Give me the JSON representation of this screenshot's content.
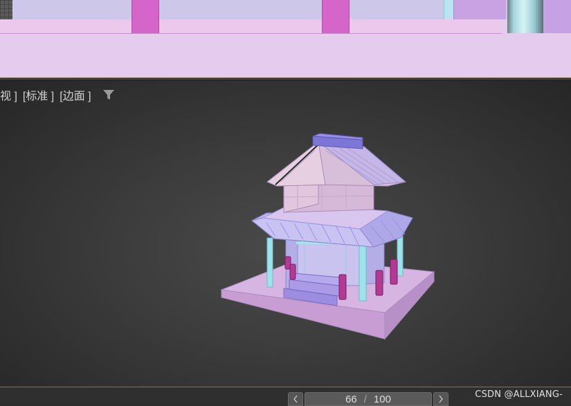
{
  "viewport_label": {
    "view_mode": "视 ]",
    "shading_mode": "[标准 ]",
    "display_mode": "[边面 ]",
    "filter_icon": "filter-icon"
  },
  "time_slider": {
    "current_frame": "66",
    "separator": "/",
    "total_frames": "100",
    "prev_icon": "chevron-left-icon",
    "next_icon": "chevron-right-icon"
  },
  "watermark": "CSDN @ALLXIANG-",
  "colors": {
    "model_pink": "#e2b9e8",
    "model_lavender": "#a8a4e8",
    "model_cyan": "#9fe3ea",
    "model_magenta": "#b02a8e",
    "viewport_bg": "#3b3b3b"
  }
}
